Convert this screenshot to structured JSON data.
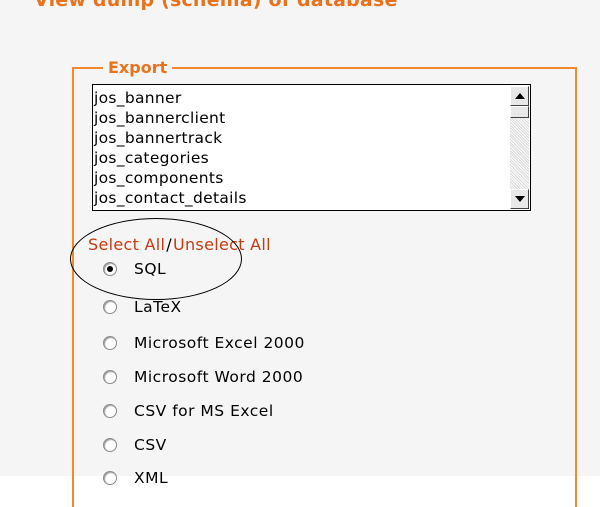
{
  "page": {
    "heading": "View dump (schema) of database"
  },
  "export": {
    "legend": "Export",
    "tables": [
      "jos_banner",
      "jos_bannerclient",
      "jos_bannertrack",
      "jos_categories",
      "jos_components",
      "jos_contact_details"
    ],
    "select_all": "Select All",
    "separator": "/",
    "unselect_all": "Unselect All",
    "formats": [
      {
        "label": "SQL",
        "selected": true
      },
      {
        "label": "LaTeX",
        "selected": false
      },
      {
        "label": "Microsoft Excel 2000",
        "selected": false
      },
      {
        "label": "Microsoft Word 2000",
        "selected": false
      },
      {
        "label": "CSV for MS Excel",
        "selected": false
      },
      {
        "label": "CSV",
        "selected": false
      },
      {
        "label": "XML",
        "selected": false
      }
    ]
  },
  "colors": {
    "accent_orange": "#e8731e",
    "link_red": "#c43b12",
    "border_orange": "#f28a2d"
  },
  "icons": {
    "scroll_up": "scroll-up-arrow-icon",
    "scroll_down": "scroll-down-arrow-icon",
    "radio": "radio-button-icon"
  }
}
